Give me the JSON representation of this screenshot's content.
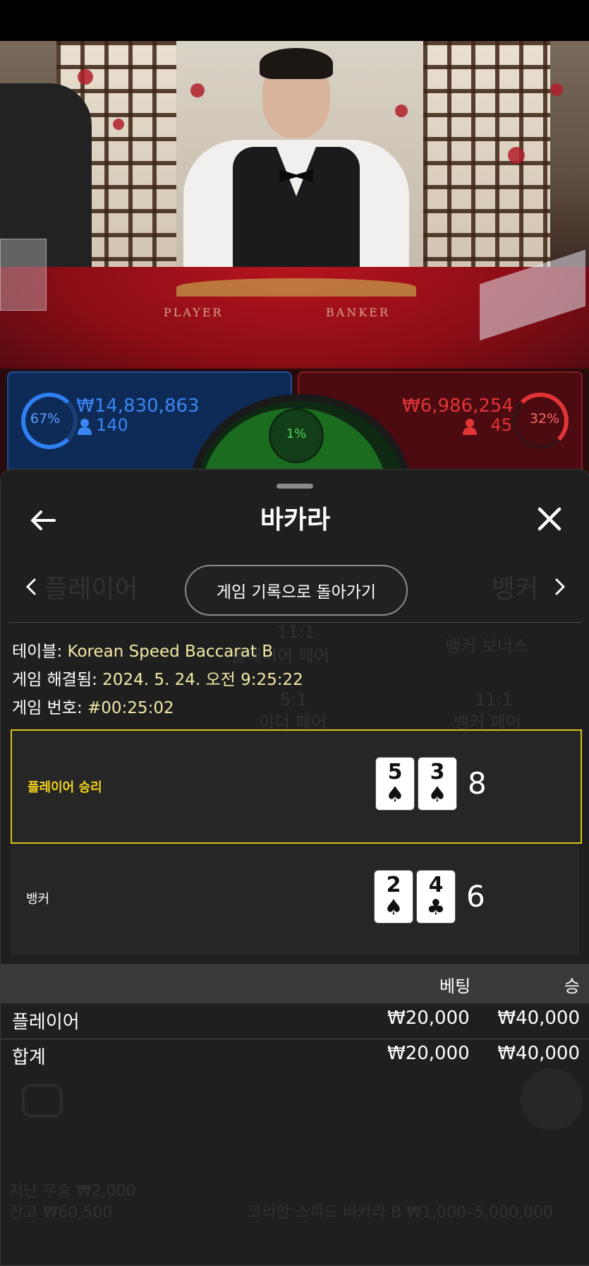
{
  "video": {
    "table_player_text": "PLAYER",
    "table_banker_text": "BANKER"
  },
  "bet_bar": {
    "player": {
      "percent": "67%",
      "amount": "₩14,830,863",
      "players": "140",
      "color": "#2f7ff0"
    },
    "tie": {
      "percent": "1%",
      "color": "#4fd65a"
    },
    "banker": {
      "percent": "32%",
      "amount": "₩6,986,254",
      "players": "45",
      "color": "#e23437"
    }
  },
  "sheet": {
    "title": "바카라",
    "return_button": "게임 기록으로 돌아가기",
    "icons": {
      "back": "arrow-left-icon",
      "close": "close-icon",
      "prev": "chevron-left-icon",
      "next": "chevron-right-icon",
      "user": "user-icon"
    },
    "info": {
      "table_label": "테이블: ",
      "table_value": "Korean Speed Baccarat B",
      "resolved_label": "게임 해결됨: ",
      "resolved_value": "2024. 5. 24. 오전 9:25:22",
      "game_no_label": "게임 번호: ",
      "game_no_value": "#00:25:02"
    },
    "results": [
      {
        "label": "플레이어 승리",
        "winner": true,
        "cards": [
          {
            "rank": "5",
            "suit": "♠"
          },
          {
            "rank": "3",
            "suit": "♠"
          }
        ],
        "score": "8"
      },
      {
        "label": "뱅커",
        "winner": false,
        "cards": [
          {
            "rank": "2",
            "suit": "♠"
          },
          {
            "rank": "4",
            "suit": "♣"
          }
        ],
        "score": "6"
      }
    ],
    "bets_table": {
      "headers": {
        "bet": "베팅",
        "win": "승"
      },
      "rows": [
        {
          "name": "플레이어",
          "bet": "₩20,000",
          "win": "₩40,000"
        },
        {
          "name": "합계",
          "bet": "₩20,000",
          "win": "₩40,000"
        }
      ]
    },
    "accent_color": "#d9c31c"
  },
  "background_ghost": {
    "player_tab": "플레이어",
    "banker_tab": "뱅커",
    "odds_player_pair": "11:1",
    "player_pair": "플레이어 페어",
    "banker_bonus": "뱅커 보너스",
    "odds_either": "5:1",
    "either_pair": "이더 페어",
    "odds_banker_pair": "11:1",
    "banker_pair": "뱅커 페어",
    "last_win": "지난 우승 ₩2,000",
    "balance": "잔고 ₩60,500",
    "table_limits": "코리안 스피드 바카라 B ₩1,000–5,000,000"
  }
}
